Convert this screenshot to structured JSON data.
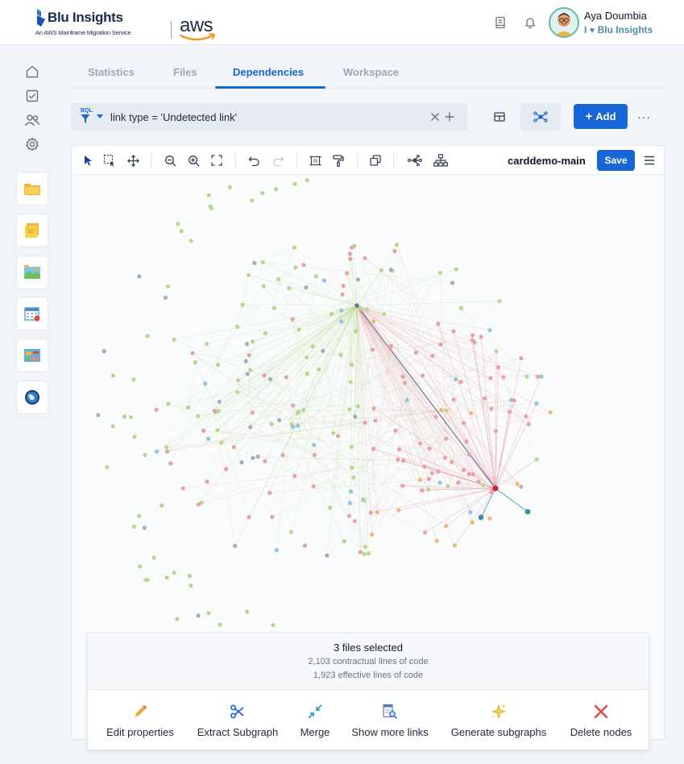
{
  "header": {
    "brand_title": "Blu Insights",
    "brand_subtitle": "An AWS Mainframe Migration Service",
    "partner": "aws",
    "user_name": "Aya Doumbia",
    "user_tag_prefix": "I",
    "user_tag": "Blu Insights"
  },
  "tabs": [
    {
      "label": "Statistics",
      "active": false
    },
    {
      "label": "Files",
      "active": false
    },
    {
      "label": "Dependencies",
      "active": true
    },
    {
      "label": "Workspace",
      "active": false
    }
  ],
  "filter": {
    "badge": "BQL",
    "query": "link type = 'Undetected link'"
  },
  "actions": {
    "add_label": "Add",
    "more_label": "···"
  },
  "graph": {
    "name": "carddemo-main",
    "save_label": "Save"
  },
  "selection": {
    "title": "3 files selected",
    "contractual": "2,103 contractual lines of code",
    "effective": "1,923 effective lines of code",
    "actions": [
      {
        "label": "Edit properties",
        "icon": "pencil-icon"
      },
      {
        "label": "Extract Subgraph",
        "icon": "scissors-icon"
      },
      {
        "label": "Merge",
        "icon": "merge-icon"
      },
      {
        "label": "Show more links",
        "icon": "document-search-icon"
      },
      {
        "label": "Generate subgraphs",
        "icon": "sparkles-icon"
      },
      {
        "label": "Delete nodes",
        "icon": "close-icon"
      }
    ]
  },
  "colors": {
    "primary": "#1866d6",
    "node_green": "#b5d98a",
    "node_pink": "#e9a0a6",
    "node_orange": "#f2b872",
    "node_blue": "#8fc6e0",
    "node_gray": "#a7adb8",
    "hub_red": "#c7263a",
    "hub_teal": "#3a8fb0"
  }
}
